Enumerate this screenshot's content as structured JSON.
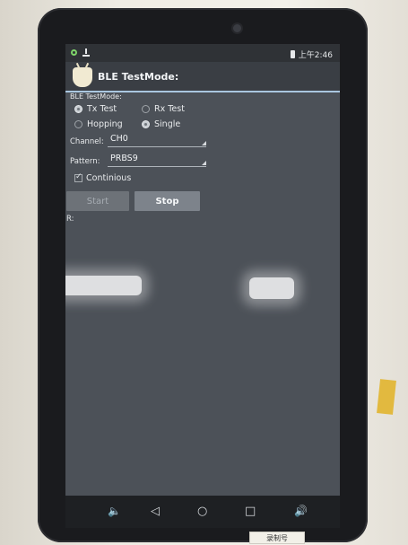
{
  "status_bar": {
    "time": "上午2:46",
    "icons": [
      "sync-icon",
      "download-icon",
      "battery-icon"
    ]
  },
  "action_bar": {
    "title": "BLE TestMode:",
    "app_icon": "android-icon"
  },
  "form": {
    "section_label": "BLE TestMode:",
    "mode_radios": [
      {
        "label": "Tx Test",
        "checked": true
      },
      {
        "label": "Rx Test",
        "checked": false
      }
    ],
    "hop_radios": [
      {
        "label": "Hopping",
        "checked": false
      },
      {
        "label": "Single",
        "checked": true
      }
    ],
    "channel": {
      "label": "Channel:",
      "value": "CH0"
    },
    "pattern": {
      "label": "Pattern:",
      "value": "PRBS9"
    },
    "continuous": {
      "label": "Continious",
      "checked": true
    },
    "buttons": {
      "start": "Start",
      "stop": "Stop"
    },
    "result_label": "R:"
  },
  "nav_bar": {
    "icons": [
      "volume-down-icon",
      "back-icon",
      "home-icon",
      "recents-icon",
      "volume-up-icon"
    ],
    "glyphs": {
      "vol_down": "🔈",
      "back": "◁",
      "home": "○",
      "recents": "□",
      "vol_up": "🔊"
    }
  },
  "label_sticker": "录制号"
}
